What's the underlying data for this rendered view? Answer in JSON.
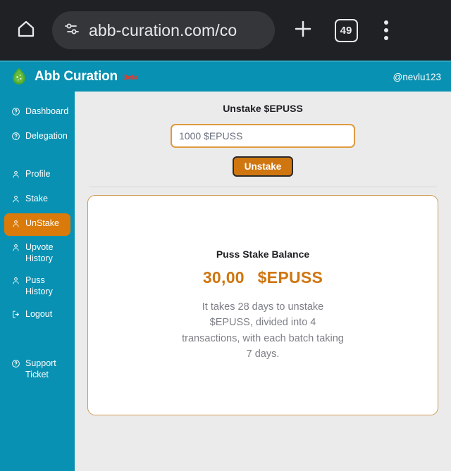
{
  "browser": {
    "home_icon": "home-icon",
    "tune_icon": "tune-icon",
    "url": "abb-curation.com/co",
    "new_tab_icon": "plus-icon",
    "tab_count": "49",
    "menu_icon": "more-vertical-icon"
  },
  "header": {
    "logo_icon": "leaf-logo-icon",
    "brand": "Abb Curation",
    "beta_label": "Beta",
    "user_handle": "@nevlu123",
    "background_color": "#0891b2"
  },
  "sidebar": {
    "background_color": "#0891b2",
    "active_color": "#d97a0b",
    "items": [
      {
        "label": "Dashboard",
        "icon": "help-circle-icon",
        "active": false
      },
      {
        "label": "Delegation",
        "icon": "help-circle-icon",
        "active": false
      },
      {
        "label": "Profile",
        "icon": "user-icon",
        "active": false
      },
      {
        "label": "Stake",
        "icon": "user-icon",
        "active": false
      },
      {
        "label": "UnStake",
        "icon": "user-icon",
        "active": true
      },
      {
        "label": "Upvote History",
        "icon": "user-icon",
        "active": false
      },
      {
        "label": "Puss History",
        "icon": "user-icon",
        "active": false
      },
      {
        "label": "Logout",
        "icon": "logout-icon",
        "active": false
      },
      {
        "label": "Support Ticket",
        "icon": "help-circle-icon",
        "active": false
      }
    ]
  },
  "main": {
    "title": "Unstake $EPUSS",
    "amount_input": {
      "value": "",
      "placeholder": "1000 $EPUSS"
    },
    "submit_label": "Unstake",
    "card": {
      "title": "Puss Stake Balance",
      "amount": "30,00",
      "ticker": "$EPUSS",
      "note": "It takes 28 days to unstake $EPUSS, divided into 4 transactions, with each batch taking 7 days.",
      "accent_color": "#cf7610",
      "border_color": "#cf9a52"
    }
  }
}
